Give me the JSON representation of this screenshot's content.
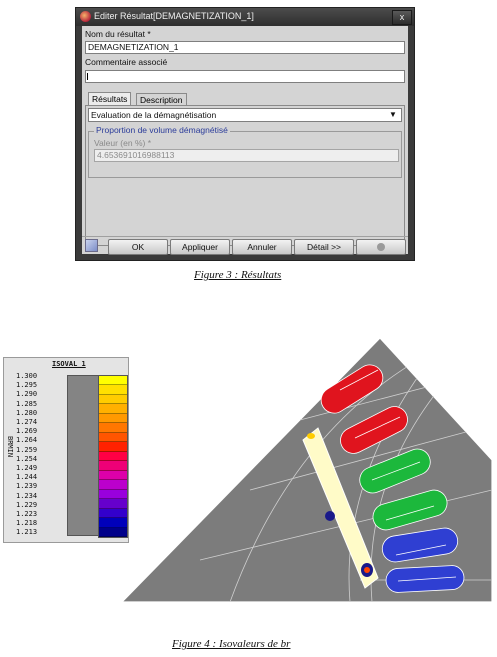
{
  "dialog": {
    "title": "Editer Résultat[DEMAGNETIZATION_1]",
    "close_label": "x",
    "name_label": "Nom du résultat *",
    "name_value": "DEMAGNETIZATION_1",
    "comment_label": "Commentaire associé",
    "comment_value": "",
    "tabs": [
      "Résultats",
      "Description"
    ],
    "dropdown_value": "Evaluation de la démagnétisation",
    "group_title": "Proportion de volume démagnétisé",
    "value_label": "Valeur (en %) *",
    "value_value": "4.653691016988113",
    "buttons": [
      "OK",
      "Appliquer",
      "Annuler",
      "Détail >>"
    ]
  },
  "captions": {
    "fig3": "Figure 3 : Résultats",
    "fig4": "Figure 4 :  Isovaleurs de br"
  },
  "legend": {
    "title": "ISOVAL_1",
    "side_label": "BRMIN",
    "values": [
      "1.300",
      "1.295",
      "1.290",
      "1.285",
      "1.280",
      "1.274",
      "1.269",
      "1.264",
      "1.259",
      "1.254",
      "1.249",
      "1.244",
      "1.239",
      "1.234",
      "1.229",
      "1.223",
      "1.218",
      "1.213"
    ],
    "colors": [
      "#ffff00",
      "#ffe000",
      "#ffcc00",
      "#ffb000",
      "#ff9900",
      "#ff7700",
      "#ff5500",
      "#ff2200",
      "#ff0044",
      "#ee0077",
      "#dd00aa",
      "#bb00cc",
      "#9900dd",
      "#6600cc",
      "#3300cc",
      "#0000bb",
      "#00008a"
    ]
  },
  "colors": {
    "red": "#e0141e",
    "green": "#1cb83c",
    "blue": "#2f3fd2",
    "mesh_gray": "#7a7a7a",
    "magnet": "#fffbc8"
  }
}
